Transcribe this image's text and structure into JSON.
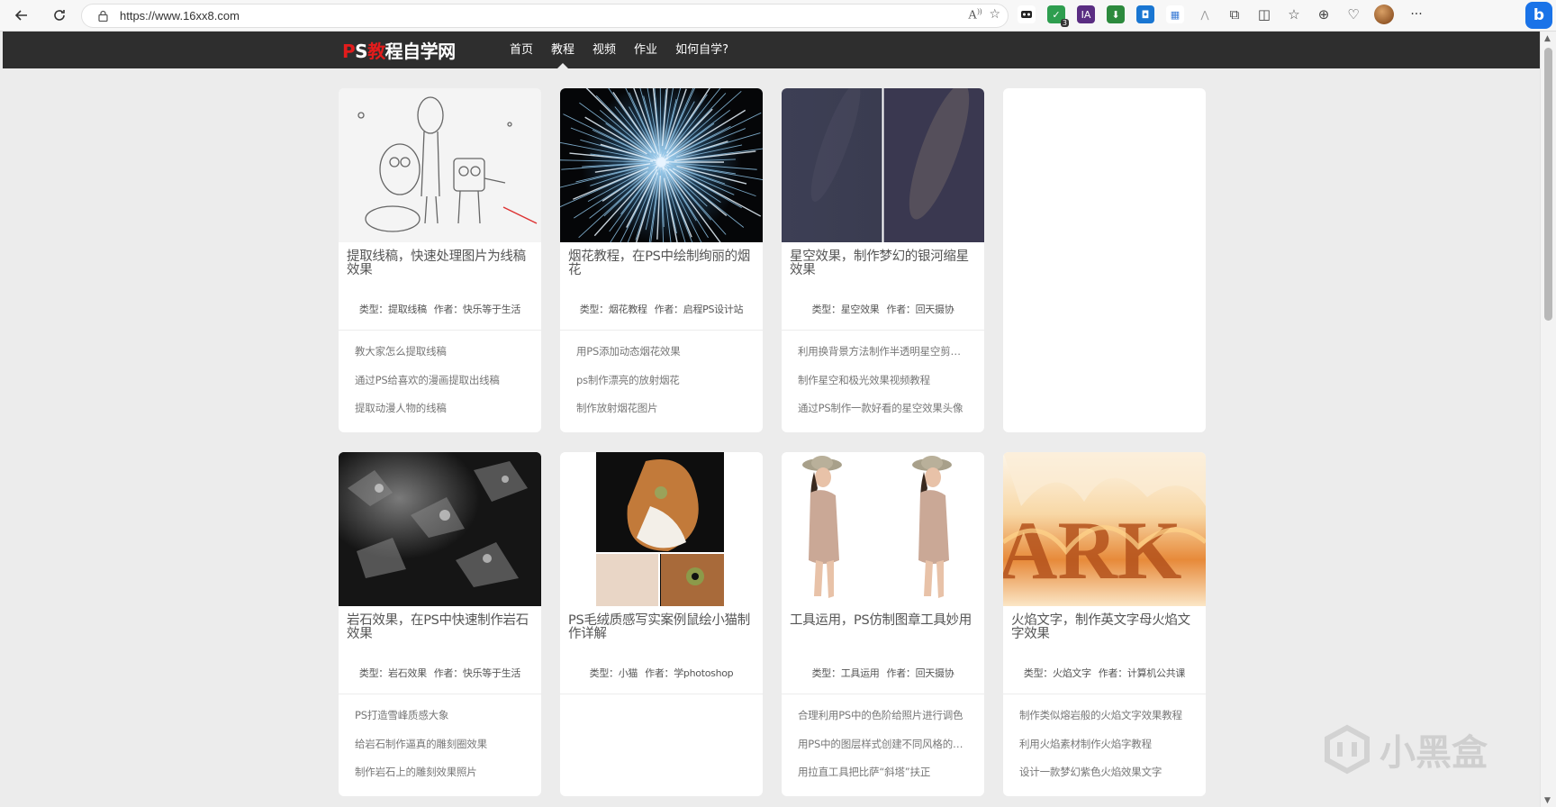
{
  "browser": {
    "url": "https://www.16xx8.com",
    "read_aloud": "A",
    "extension_badge": "3",
    "ext_ia": "IA",
    "more": "···",
    "bing": "b"
  },
  "site": {
    "logo_red_1": "P",
    "logo_white_1": "S",
    "logo_red_2": "教",
    "logo_white_2": "程自学网",
    "nav": [
      "首页",
      "教程",
      "视频",
      "作业",
      "如何自学?"
    ],
    "active_nav_index": 1
  },
  "cards": [
    {
      "title": "提取线稿，快速处理图片为线稿效果",
      "type": "类型：提取线稿",
      "author": "作者：快乐等于生活",
      "links": [
        "教大家怎么提取线稿",
        "通过PS给喜欢的漫画提取出线稿",
        "提取动漫人物的线稿"
      ],
      "thumb": "sketch"
    },
    {
      "title": "烟花教程，在PS中绘制绚丽的烟花",
      "type": "类型：烟花教程",
      "author": "作者：启程PS设计站",
      "links": [
        "用PS添加动态烟花效果",
        "ps制作漂亮的放射烟花",
        "制作放射烟花图片"
      ],
      "thumb": "fire"
    },
    {
      "title": "星空效果，制作梦幻的银河缩星效果",
      "type": "类型：星空效果",
      "author": "作者：回天摄协",
      "links": [
        "利用换背景方法制作半透明星空剪…",
        "制作星空和极光效果视频教程",
        "通过PS制作一款好看的星空效果头像"
      ],
      "thumb": "stars"
    },
    {
      "title": "",
      "type": "",
      "author": "",
      "links": [],
      "thumb": "blank"
    },
    {
      "title": "岩石效果，在PS中快速制作岩石效果",
      "type": "类型：岩石效果",
      "author": "作者：快乐等于生活",
      "links": [
        "PS打造雪峰质感大象",
        "给岩石制作逼真的雕刻圈效果",
        "制作岩石上的雕刻效果照片"
      ],
      "thumb": "rock"
    },
    {
      "title": "PS毛绒质感写实案例鼠绘小猫制作详解",
      "type": "类型：小猫",
      "author": "作者：学photoshop",
      "links": [],
      "thumb": "cat"
    },
    {
      "title": "工具运用，PS仿制图章工具妙用",
      "type": "类型：工具运用",
      "author": "作者：回天摄协",
      "links": [
        "合理利用PS中的色阶给照片进行调色",
        "用PS中的图层样式创建不同风格的…",
        "用拉直工具把比萨“斜塔”扶正"
      ],
      "thumb": "girls"
    },
    {
      "title": "火焰文字，制作英文字母火焰文字效果",
      "type": "类型：火焰文字",
      "author": "作者：计算机公共课",
      "links": [
        "制作类似熔岩般的火焰文字效果教程",
        "利用火焰素材制作火焰字教程",
        "设计一款梦幻紫色火焰效果文字"
      ],
      "thumb": "flame"
    }
  ],
  "watermark": {
    "text": "小黑盒"
  },
  "thumb_texts": {
    "flame_letters": "ARK"
  }
}
